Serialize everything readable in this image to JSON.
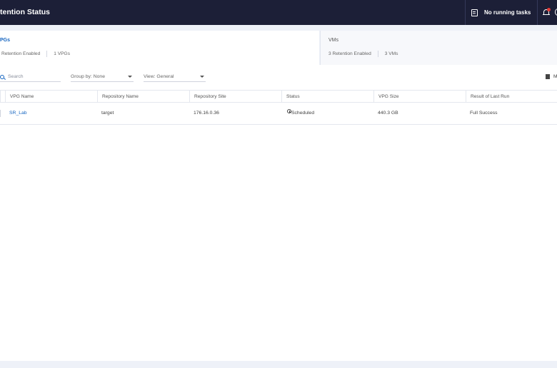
{
  "header": {
    "title": "tention Status",
    "tasks_label": "No running tasks",
    "tasks_icon": "tasks-icon",
    "notification_icon": "bell-icon"
  },
  "summary": {
    "vpgs": {
      "title": "PGs",
      "retention_enabled": "Retention Enabled",
      "count": "1 VPGs"
    },
    "vms": {
      "title": "VMs",
      "retention_enabled": "3 Retention Enabled",
      "count": "3 VMs"
    }
  },
  "filters": {
    "search_placeholder": "Search",
    "group_by": "Group by: None",
    "view": "View: General",
    "more_label": "M"
  },
  "table": {
    "columns": [
      "VPG Name",
      "Repository Name",
      "Repository Site",
      "Status",
      "VPG Size",
      "Result of Last Run"
    ],
    "rows": [
      {
        "vpg_name": "SR_Lab",
        "repository_name": "target",
        "repository_site": "176.16.0.36",
        "status": "Scheduled",
        "vpg_size": "440.3 GB",
        "last_run": "Full Success"
      }
    ]
  },
  "colors": {
    "header_bg": "#1c1f37",
    "accent": "#1565c0",
    "page_bg": "#eef1f8"
  }
}
